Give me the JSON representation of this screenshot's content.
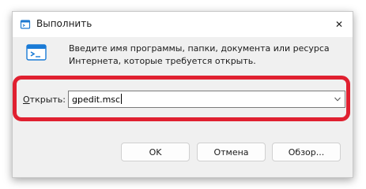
{
  "window": {
    "title": "Выполнить",
    "close_glyph": "✕",
    "icon_name": "run-icon"
  },
  "content": {
    "description": "Введите имя программы, папки, документа или ресурса Интернета, которые требуется открыть.",
    "open_label_underlined": "О",
    "open_label_rest": "ткрыть:",
    "combo_value": "gpedit.msc",
    "combo_arrow_icon": "chevron-down-icon"
  },
  "buttons": {
    "ok": "OK",
    "cancel": "Отмена",
    "browse": "Обзор..."
  },
  "colors": {
    "highlight": "#e02030",
    "accent": "#0078d4"
  }
}
